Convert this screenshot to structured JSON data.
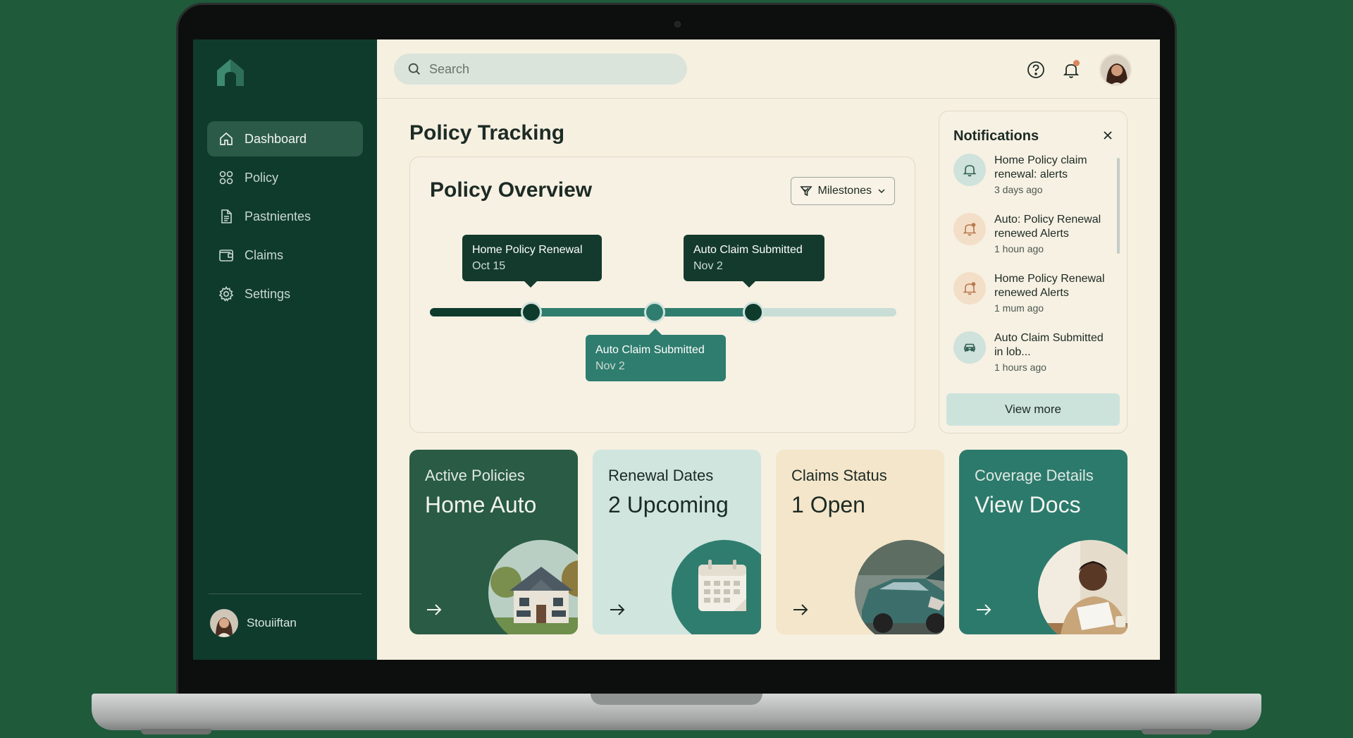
{
  "sidebar": {
    "items": [
      {
        "label": "Dashboard",
        "icon": "home-icon",
        "active": true
      },
      {
        "label": "Policy",
        "icon": "grid-icon"
      },
      {
        "label": "Pastnientes",
        "icon": "document-icon"
      },
      {
        "label": "Claims",
        "icon": "wallet-icon"
      },
      {
        "label": "Settings",
        "icon": "gear-icon"
      }
    ],
    "user_name": "Stouiiftan"
  },
  "search": {
    "placeholder": "Search"
  },
  "page_title": "Policy Tracking",
  "overview": {
    "title": "Policy Overview",
    "milestones_label": "Milestones",
    "milestones": [
      {
        "title": "Home Policy Renewal",
        "date": "Oct 15"
      },
      {
        "title": "Auto Claim Submitted",
        "date": "Nov 2"
      },
      {
        "title": "Auto Claim Submitted",
        "date": "Nov 2"
      }
    ]
  },
  "notifications": {
    "title": "Notifications",
    "items": [
      {
        "text": "Home Policy claim renewal: alerts",
        "time": "3 days ago",
        "icon": "bell-icon"
      },
      {
        "text": "Auto: Policy Renewal renewed Alerts",
        "time": "1 houn ago",
        "icon": "bell-alert-icon"
      },
      {
        "text": "Home Policy Renewal renewed Alerts",
        "time": "1 mum ago",
        "icon": "bell-alert-icon"
      },
      {
        "text": "Auto Claim Submitted in lob...",
        "time": "1 hours ago",
        "icon": "car-icon"
      }
    ],
    "view_more": "View more"
  },
  "cards": [
    {
      "label": "Active Policies",
      "value": "Home Auto",
      "image": "house-image"
    },
    {
      "label": "Renewal Dates",
      "value": "2 Upcoming",
      "image": "calendar-image"
    },
    {
      "label": "Claims Status",
      "value": "1 Open",
      "image": "damaged-car-image"
    },
    {
      "label": "Coverage Details",
      "value": "View Docs",
      "image": "person-reading-image"
    }
  ],
  "colors": {
    "sidebar": "#0f3b2d",
    "accent_teal": "#2f7d6f",
    "background": "#f6f0e1",
    "notification_dot": "#d9875e"
  }
}
